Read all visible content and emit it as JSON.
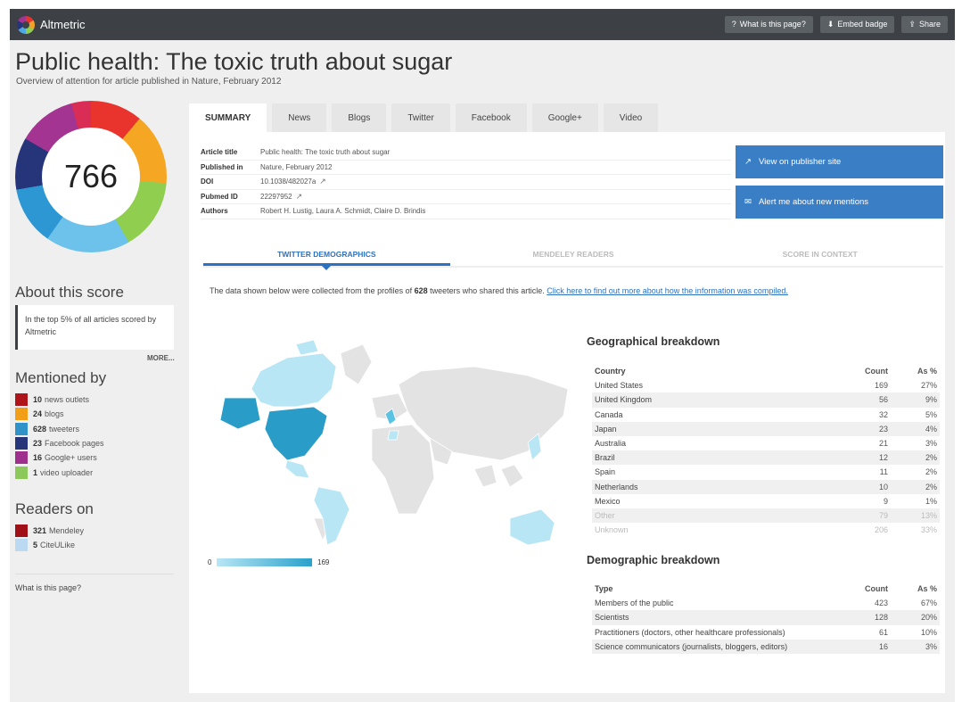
{
  "app": {
    "name": "Altmetric"
  },
  "topbar": {
    "what_label": "What is this page?",
    "embed_label": "Embed badge",
    "share_label": "Share"
  },
  "page": {
    "title": "Public health: The toxic truth about sugar",
    "subtitle": "Overview of attention for article published in Nature, February 2012"
  },
  "score": {
    "value": "766"
  },
  "about": {
    "heading": "About this score",
    "text": "In the top 5% of all articles scored by Altmetric",
    "more": "MORE..."
  },
  "mentioned": {
    "heading": "Mentioned by",
    "items": [
      {
        "count": "10",
        "label": "news outlets",
        "color": "#b0141b"
      },
      {
        "count": "24",
        "label": "blogs",
        "color": "#f29e17"
      },
      {
        "count": "628",
        "label": "tweeters",
        "color": "#2f93c9"
      },
      {
        "count": "23",
        "label": "Facebook pages",
        "color": "#26357a"
      },
      {
        "count": "16",
        "label": "Google+ users",
        "color": "#9e2f8c"
      },
      {
        "count": "1",
        "label": "video uploader",
        "color": "#8cc85a"
      }
    ]
  },
  "readers": {
    "heading": "Readers on",
    "items": [
      {
        "count": "321",
        "label": "Mendeley",
        "color": "#a10f17"
      },
      {
        "count": "5",
        "label": "CiteULike",
        "color": "#bcd9f2"
      }
    ]
  },
  "sidebar_footer": {
    "what_label": "What is this page?"
  },
  "tabs": [
    "SUMMARY",
    "News",
    "Blogs",
    "Twitter",
    "Facebook",
    "Google+",
    "Video"
  ],
  "article": {
    "rows": [
      {
        "key": "Article title",
        "value": "Public health: The toxic truth about sugar"
      },
      {
        "key": "Published in",
        "value": "Nature, February 2012"
      },
      {
        "key": "DOI",
        "value": "10.1038/482027a"
      },
      {
        "key": "Pubmed ID",
        "value": "22297952"
      },
      {
        "key": "Authors",
        "value": "Robert H. Lustig, Laura A. Schmidt, Claire D. Brindis"
      }
    ]
  },
  "actions": {
    "publisher_label": "View on publisher site",
    "alert_label": "Alert me about new mentions"
  },
  "subtabs": [
    "TWITTER DEMOGRAPHICS",
    "MENDELEY READERS",
    "SCORE IN CONTEXT"
  ],
  "notice": {
    "before": "The data shown below were collected from the profiles of ",
    "count": "628",
    "after": " tweeters who shared this article. ",
    "link": "Click here to find out more about how the information was compiled."
  },
  "map_legend": {
    "min": "0",
    "max": "169",
    "color_low": "#b8e6f5",
    "color_high": "#2aa1cb"
  },
  "geo": {
    "heading": "Geographical breakdown",
    "headers": [
      "Country",
      "Count",
      "As %"
    ],
    "rows": [
      [
        "United States",
        "169",
        "27%"
      ],
      [
        "United Kingdom",
        "56",
        "9%"
      ],
      [
        "Canada",
        "32",
        "5%"
      ],
      [
        "Japan",
        "23",
        "4%"
      ],
      [
        "Australia",
        "21",
        "3%"
      ],
      [
        "Brazil",
        "12",
        "2%"
      ],
      [
        "Spain",
        "11",
        "2%"
      ],
      [
        "Netherlands",
        "10",
        "2%"
      ],
      [
        "Mexico",
        "9",
        "1%"
      ],
      [
        "Other",
        "79",
        "13%"
      ],
      [
        "Unknown",
        "206",
        "33%"
      ]
    ]
  },
  "demo": {
    "heading": "Demographic breakdown",
    "headers": [
      "Type",
      "Count",
      "As %"
    ],
    "rows": [
      [
        "Members of the public",
        "423",
        "67%"
      ],
      [
        "Scientists",
        "128",
        "20%"
      ],
      [
        "Practitioners (doctors, other healthcare professionals)",
        "61",
        "10%"
      ],
      [
        "Science communicators (journalists, bloggers, editors)",
        "16",
        "3%"
      ]
    ]
  }
}
